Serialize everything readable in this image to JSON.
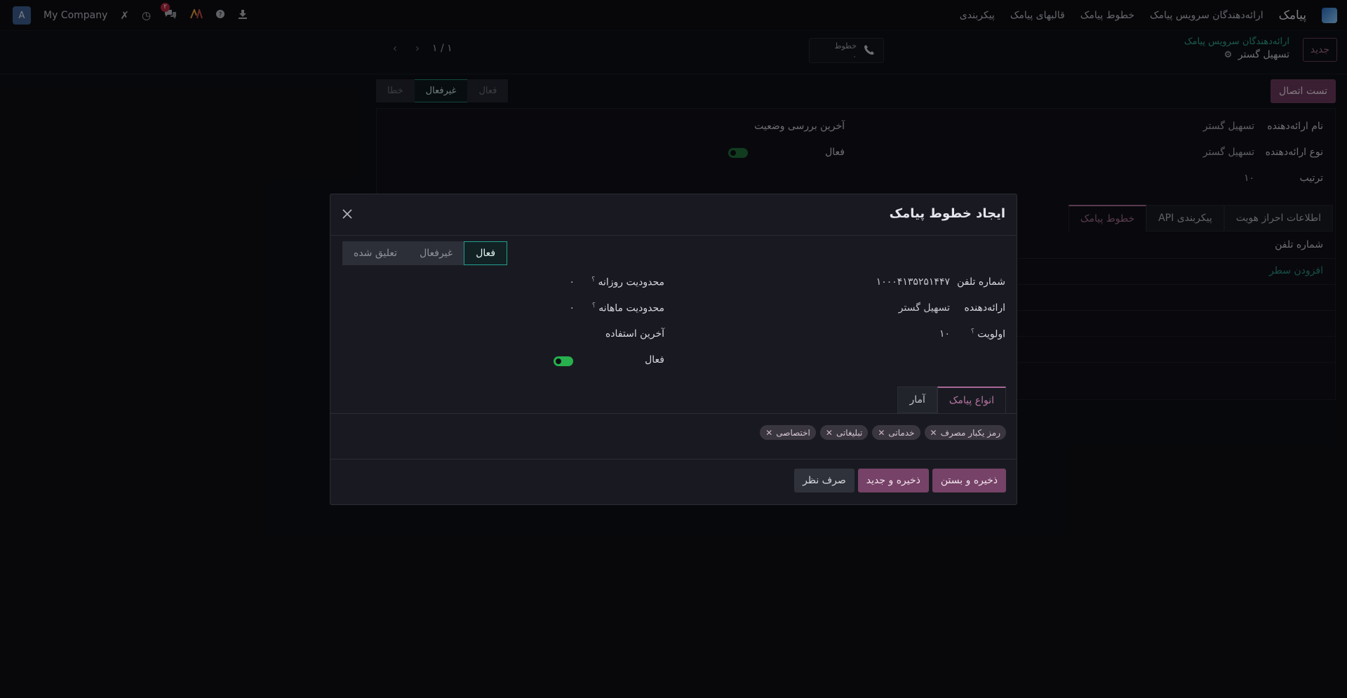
{
  "navbar": {
    "app_name": "پیامک",
    "menu": [
      "ارائه‌دهندگان سرویس پیامک",
      "خطوط پیامک",
      "قالبهای پیامک",
      "پیکربندی"
    ],
    "company": "My Company",
    "avatar_letter": "A",
    "chat_badge": "۲"
  },
  "control": {
    "new_label": "جدید",
    "breadcrumb_link": "ارائه‌دهندگان سرویس پیامک",
    "breadcrumb_title": "تسهیل گستر",
    "lines_label": "خطوط",
    "lines_count": "۰",
    "pager": "۱ / ۱"
  },
  "background_form": {
    "stages": [
      "خطا",
      "غیرفعال",
      "فعال"
    ],
    "active_stage": "غیرفعال",
    "test_button": "تست اتصال",
    "provider_name_label": "نام ارائه‌دهنده",
    "provider_name_value": "تسهیل گستر",
    "provider_type_label": "نوع ارائه‌دهنده",
    "provider_type_value": "تسهیل گستر",
    "sequence_label": "ترتیب",
    "sequence_value": "۱۰",
    "last_check_label": "آخرین بررسی وضعیت",
    "active_label": "فعال",
    "tabs": [
      "اطلاعات احراز هویت",
      "پیکربندی API",
      "خطوط پیامک"
    ],
    "active_tab": "خطوط پیامک",
    "column_phone": "شماره تلفن",
    "add_line": "افزودن سطر"
  },
  "modal": {
    "title": "ایجاد خطوط پیامک",
    "stages": [
      "تعلیق شده",
      "غیرفعال",
      "فعال"
    ],
    "active_stage": "فعال",
    "phone_label": "شماره تلفن",
    "phone_value": "۱۰۰۰۴۱۳۵۲۵۱۴۴۷",
    "provider_label": "ارائه‌دهنده",
    "provider_value": "تسهیل گستر",
    "priority_label": "اولویت",
    "priority_value": "۱۰",
    "daily_limit_label": "محدودیت روزانه",
    "daily_limit_value": "۰",
    "monthly_limit_label": "محدودیت ماهانه",
    "monthly_limit_value": "۰",
    "last_used_label": "آخرین استفاده",
    "active_label": "فعال",
    "help_mark": "؟",
    "tabs": [
      "انواع پیامک",
      "آمار"
    ],
    "tags": [
      "رمز یکبار مصرف",
      "خدماتی",
      "تبلیغاتی",
      "اختصاصی"
    ],
    "save_close": "ذخیره و بستن",
    "save_new": "ذخیره و جدید",
    "discard": "صرف نظر"
  }
}
